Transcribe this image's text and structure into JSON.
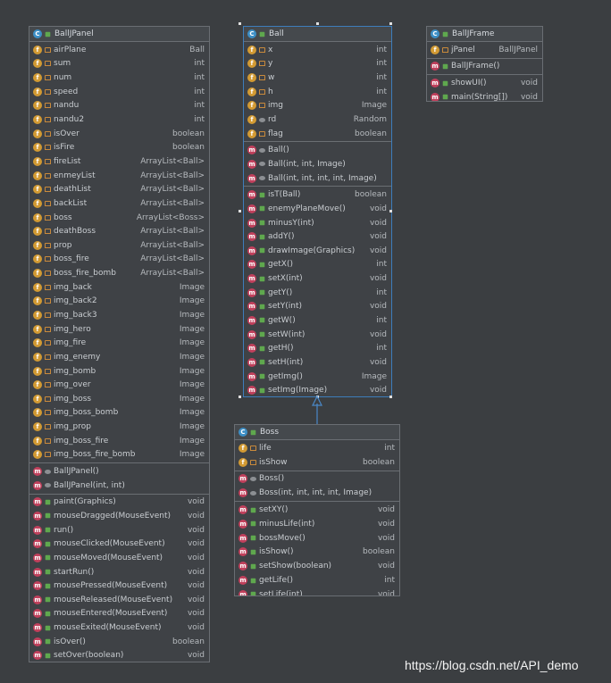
{
  "classes": {
    "balljpanel": {
      "name": "BallJPanel",
      "fields": [
        {
          "name": "airPlane",
          "type": "Ball",
          "vis": "priv"
        },
        {
          "name": "sum",
          "type": "int",
          "vis": "priv"
        },
        {
          "name": "num",
          "type": "int",
          "vis": "priv"
        },
        {
          "name": "speed",
          "type": "int",
          "vis": "priv"
        },
        {
          "name": "nandu",
          "type": "int",
          "vis": "priv"
        },
        {
          "name": "nandu2",
          "type": "int",
          "vis": "priv"
        },
        {
          "name": "isOver",
          "type": "boolean",
          "vis": "priv"
        },
        {
          "name": "isFire",
          "type": "boolean",
          "vis": "priv"
        },
        {
          "name": "fireList",
          "type": "ArrayList<Ball>",
          "vis": "priv"
        },
        {
          "name": "enmeyList",
          "type": "ArrayList<Ball>",
          "vis": "priv"
        },
        {
          "name": "deathList",
          "type": "ArrayList<Ball>",
          "vis": "priv"
        },
        {
          "name": "backList",
          "type": "ArrayList<Ball>",
          "vis": "priv"
        },
        {
          "name": "boss",
          "type": "ArrayList<Boss>",
          "vis": "priv"
        },
        {
          "name": "deathBoss",
          "type": "ArrayList<Ball>",
          "vis": "priv"
        },
        {
          "name": "prop",
          "type": "ArrayList<Ball>",
          "vis": "priv"
        },
        {
          "name": "boss_fire",
          "type": "ArrayList<Ball>",
          "vis": "priv"
        },
        {
          "name": "boss_fire_bomb",
          "type": "ArrayList<Ball>",
          "vis": "priv"
        },
        {
          "name": "img_back",
          "type": "Image",
          "vis": "priv"
        },
        {
          "name": "img_back2",
          "type": "Image",
          "vis": "priv"
        },
        {
          "name": "img_back3",
          "type": "Image",
          "vis": "priv"
        },
        {
          "name": "img_hero",
          "type": "Image",
          "vis": "priv"
        },
        {
          "name": "img_fire",
          "type": "Image",
          "vis": "priv"
        },
        {
          "name": "img_enemy",
          "type": "Image",
          "vis": "priv"
        },
        {
          "name": "img_bomb",
          "type": "Image",
          "vis": "priv"
        },
        {
          "name": "img_over",
          "type": "Image",
          "vis": "priv"
        },
        {
          "name": "img_boss",
          "type": "Image",
          "vis": "priv"
        },
        {
          "name": "img_boss_bomb",
          "type": "Image",
          "vis": "priv"
        },
        {
          "name": "img_prop",
          "type": "Image",
          "vis": "priv"
        },
        {
          "name": "img_boss_fire",
          "type": "Image",
          "vis": "priv"
        },
        {
          "name": "img_boss_fire_bomb",
          "type": "Image",
          "vis": "priv"
        }
      ],
      "constructors": [
        {
          "name": "BallJPanel()",
          "type": "",
          "vis": "pkg"
        },
        {
          "name": "BallJPanel(int, int)",
          "type": "",
          "vis": "pkg"
        }
      ],
      "methods": [
        {
          "name": "paint(Graphics)",
          "type": "void",
          "vis": "pub"
        },
        {
          "name": "mouseDragged(MouseEvent)",
          "type": "void",
          "vis": "pub"
        },
        {
          "name": "run()",
          "type": "void",
          "vis": "pub"
        },
        {
          "name": "mouseClicked(MouseEvent)",
          "type": "void",
          "vis": "pub"
        },
        {
          "name": "mouseMoved(MouseEvent)",
          "type": "void",
          "vis": "pub"
        },
        {
          "name": "startRun()",
          "type": "void",
          "vis": "pub"
        },
        {
          "name": "mousePressed(MouseEvent)",
          "type": "void",
          "vis": "pub"
        },
        {
          "name": "mouseReleased(MouseEvent)",
          "type": "void",
          "vis": "pub"
        },
        {
          "name": "mouseEntered(MouseEvent)",
          "type": "void",
          "vis": "pub"
        },
        {
          "name": "mouseExited(MouseEvent)",
          "type": "void",
          "vis": "pub"
        },
        {
          "name": "isOver()",
          "type": "boolean",
          "vis": "pub"
        },
        {
          "name": "setOver(boolean)",
          "type": "void",
          "vis": "pub"
        }
      ]
    },
    "ball": {
      "name": "Ball",
      "fields": [
        {
          "name": "x",
          "type": "int",
          "vis": "priv"
        },
        {
          "name": "y",
          "type": "int",
          "vis": "priv"
        },
        {
          "name": "w",
          "type": "int",
          "vis": "priv"
        },
        {
          "name": "h",
          "type": "int",
          "vis": "priv"
        },
        {
          "name": "img",
          "type": "Image",
          "vis": "priv"
        },
        {
          "name": "rd",
          "type": "Random",
          "vis": "pkg"
        },
        {
          "name": "flag",
          "type": "boolean",
          "vis": "priv"
        }
      ],
      "constructors": [
        {
          "name": "Ball()",
          "type": "",
          "vis": "pkg"
        },
        {
          "name": "Ball(int, int, Image)",
          "type": "",
          "vis": "pkg"
        },
        {
          "name": "Ball(int, int, int, int, Image)",
          "type": "",
          "vis": "pkg"
        }
      ],
      "methods": [
        {
          "name": "isT(Ball)",
          "type": "boolean",
          "vis": "pub"
        },
        {
          "name": "enemyPlaneMove()",
          "type": "void",
          "vis": "pub"
        },
        {
          "name": "minusY(int)",
          "type": "void",
          "vis": "pub"
        },
        {
          "name": "addY()",
          "type": "void",
          "vis": "pub"
        },
        {
          "name": "drawImage(Graphics)",
          "type": "void",
          "vis": "pub"
        },
        {
          "name": "getX()",
          "type": "int",
          "vis": "pub"
        },
        {
          "name": "setX(int)",
          "type": "void",
          "vis": "pub"
        },
        {
          "name": "getY()",
          "type": "int",
          "vis": "pub"
        },
        {
          "name": "setY(int)",
          "type": "void",
          "vis": "pub"
        },
        {
          "name": "getW()",
          "type": "int",
          "vis": "pub"
        },
        {
          "name": "setW(int)",
          "type": "void",
          "vis": "pub"
        },
        {
          "name": "getH()",
          "type": "int",
          "vis": "pub"
        },
        {
          "name": "setH(int)",
          "type": "void",
          "vis": "pub"
        },
        {
          "name": "getImg()",
          "type": "Image",
          "vis": "pub"
        },
        {
          "name": "setImg(Image)",
          "type": "void",
          "vis": "pub"
        }
      ]
    },
    "balljframe": {
      "name": "BallJFrame",
      "fields": [
        {
          "name": "jPanel",
          "type": "BallJPanel",
          "vis": "priv"
        }
      ],
      "constructors": [
        {
          "name": "BallJFrame()",
          "type": "",
          "vis": "pub"
        }
      ],
      "methods": [
        {
          "name": "showUI()",
          "type": "void",
          "vis": "pub"
        },
        {
          "name": "main(String[])",
          "type": "void",
          "vis": "pub"
        }
      ]
    },
    "boss": {
      "name": "Boss",
      "fields": [
        {
          "name": "life",
          "type": "int",
          "vis": "priv"
        },
        {
          "name": "isShow",
          "type": "boolean",
          "vis": "priv"
        }
      ],
      "constructors": [
        {
          "name": "Boss()",
          "type": "",
          "vis": "pkg"
        },
        {
          "name": "Boss(int, int, int, int, Image)",
          "type": "",
          "vis": "pkg"
        }
      ],
      "methods": [
        {
          "name": "setXY()",
          "type": "void",
          "vis": "pub"
        },
        {
          "name": "minusLife(int)",
          "type": "void",
          "vis": "pub"
        },
        {
          "name": "bossMove()",
          "type": "void",
          "vis": "pub"
        },
        {
          "name": "isShow()",
          "type": "boolean",
          "vis": "pub"
        },
        {
          "name": "setShow(boolean)",
          "type": "void",
          "vis": "pub"
        },
        {
          "name": "getLife()",
          "type": "int",
          "vis": "pub"
        },
        {
          "name": "setLife(int)",
          "type": "void",
          "vis": "pub"
        }
      ]
    }
  },
  "icons": {
    "class": "C",
    "field": "f",
    "method": "m",
    "constructor": "m"
  },
  "watermark": "https://blog.csdn.net/API_demo"
}
